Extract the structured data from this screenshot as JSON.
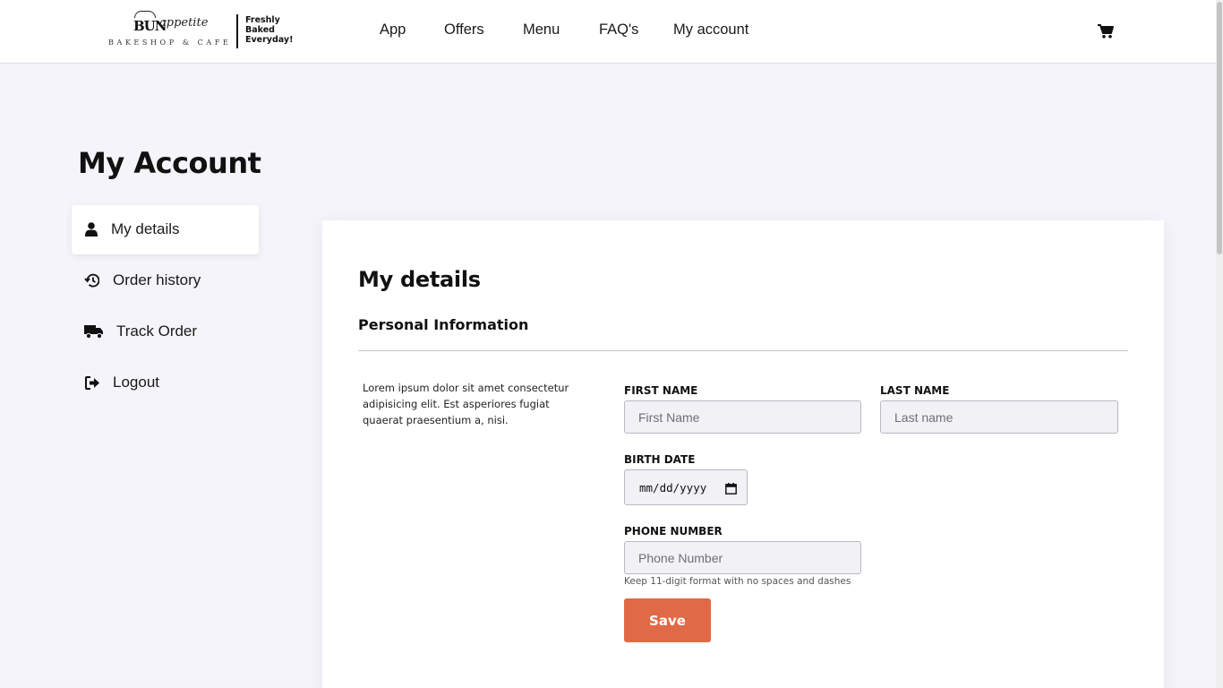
{
  "header": {
    "logo": {
      "brand_main": "BUN",
      "brand_script": "appetite",
      "brand_sub": "BAKESHOP & CAFE",
      "tagline": [
        "Freshly",
        "Baked",
        "Everyday!"
      ]
    },
    "nav": [
      {
        "label": "App"
      },
      {
        "label": "Offers"
      },
      {
        "label": "Menu"
      },
      {
        "label": "FAQ's"
      },
      {
        "label": "My account"
      }
    ],
    "cart_icon": "shopping-cart-icon"
  },
  "page": {
    "title": "My Account"
  },
  "sidebar": {
    "items": [
      {
        "label": "My details",
        "icon": "user-icon",
        "active": true
      },
      {
        "label": "Order history",
        "icon": "history-icon",
        "active": false
      },
      {
        "label": "Track Order",
        "icon": "truck-icon",
        "active": false
      },
      {
        "label": "Logout",
        "icon": "logout-icon",
        "active": false
      }
    ]
  },
  "details": {
    "title": "My details",
    "section_title": "Personal Information",
    "description": "Lorem ipsum dolor sit amet consectetur adipisicing elit. Est asperiores fugiat quaerat praesentium a, nisi.",
    "first_name": {
      "label": "FIRST NAME",
      "placeholder": "First Name",
      "value": ""
    },
    "last_name": {
      "label": "LAST NAME",
      "placeholder": "Last name",
      "value": ""
    },
    "birth_date": {
      "label": "BIRTH DATE",
      "placeholder": "mm/dd/yyyy",
      "value": ""
    },
    "phone": {
      "label": "PHONE NUMBER",
      "placeholder": "Phone Number",
      "value": "",
      "hint": "Keep 11-digit format with no spaces and dashes"
    },
    "save_label": "Save"
  },
  "colors": {
    "accent": "#e06a45",
    "page_bg": "#f4f4fa",
    "card_bg": "#ffffff",
    "input_bg": "#f1f1f6"
  }
}
